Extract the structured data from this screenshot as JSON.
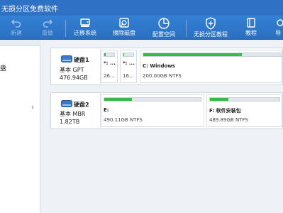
{
  "window": {
    "title": "无损分区免费软件"
  },
  "toolbar": {
    "items": [
      {
        "label": "新建",
        "icon": "undo-icon",
        "disabled": true
      },
      {
        "label": "重做",
        "icon": "redo-icon",
        "disabled": true
      },
      {
        "label": "迁移系统",
        "icon": "migrate-system-icon",
        "disabled": false
      },
      {
        "label": "擦除磁盘",
        "icon": "wipe-disk-icon",
        "disabled": false
      },
      {
        "label": "配置空间",
        "icon": "allocate-space-icon",
        "disabled": false
      },
      {
        "label": "无损分区教程",
        "icon": "shield-plus-icon",
        "disabled": false
      },
      {
        "label": "教程",
        "icon": "book-icon",
        "disabled": false
      },
      {
        "label": "导",
        "icon": "more-icon",
        "disabled": false
      }
    ]
  },
  "sidebar": {
    "items": [
      {
        "label": "盘"
      }
    ],
    "chevron": "›"
  },
  "disks": [
    {
      "name": "硬盘1",
      "type": "基本 GPT",
      "size": "476.94GB",
      "partitions": [
        {
          "name": "*: ...",
          "info": "26...",
          "used": 0.12
        },
        {
          "name": "*: ...",
          "info": "16...",
          "used": 0.08
        },
        {
          "name": "C: Windows",
          "info": "200.00GB NTFS",
          "used": 0.71
        }
      ]
    },
    {
      "name": "硬盘2",
      "type": "基本 MBR",
      "size": "1.82TB",
      "partitions": [
        {
          "name": "E:",
          "info": "490.11GB NTFS",
          "used": 0.29
        },
        {
          "name": "F: 软件安装包",
          "info": "489.89GB NTFS",
          "used": 0.27
        }
      ]
    }
  ],
  "colors": {
    "accent": "#2d72c4",
    "used_fill": "#36b84a"
  }
}
